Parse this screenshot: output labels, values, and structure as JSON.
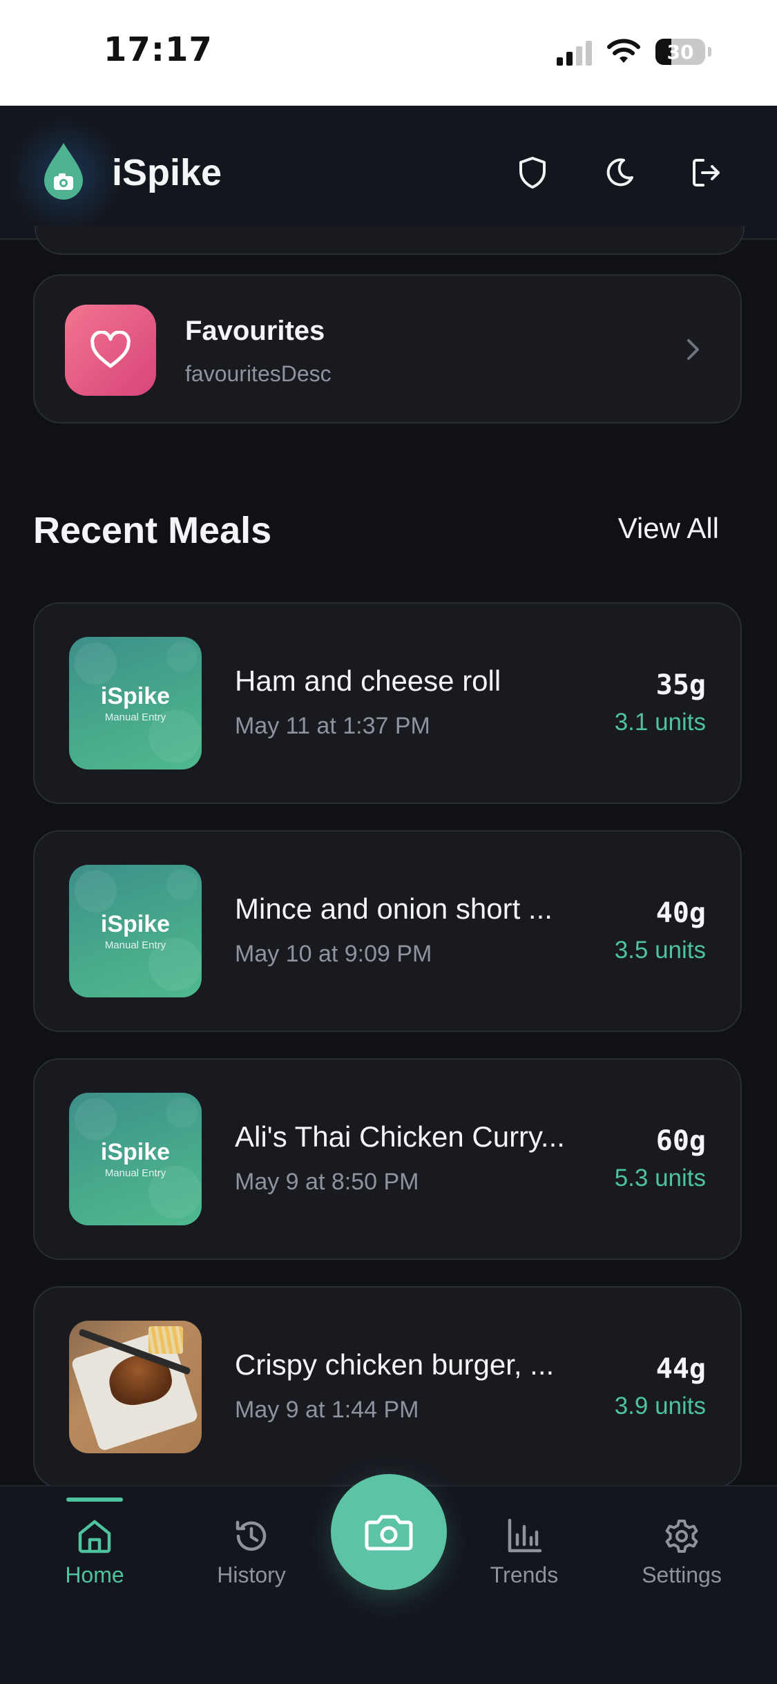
{
  "status_bar": {
    "time": "17:17",
    "battery": "30"
  },
  "header": {
    "title": "iSpike"
  },
  "favourites": {
    "title": "Favourites",
    "description": "favouritesDesc"
  },
  "recent_meals": {
    "title": "Recent Meals",
    "view_all": "View All",
    "placeholder_brand": "iSpike",
    "placeholder_sub": "Manual Entry",
    "items": [
      {
        "name": "Ham and cheese roll",
        "date": "May 11 at 1:37 PM",
        "carbs": "35g",
        "units": "3.1 units"
      },
      {
        "name": "Mince and onion short ...",
        "date": "May 10 at 9:09 PM",
        "carbs": "40g",
        "units": "3.5 units"
      },
      {
        "name": "Ali's Thai Chicken Curry...",
        "date": "May 9 at 8:50 PM",
        "carbs": "60g",
        "units": "5.3 units"
      },
      {
        "name": "Crispy chicken burger, ...",
        "date": "May 9 at 1:44 PM",
        "carbs": "44g",
        "units": "3.9 units"
      }
    ]
  },
  "nav": {
    "home": "Home",
    "history": "History",
    "trends": "Trends",
    "settings": "Settings",
    "active": "Home"
  },
  "colors": {
    "accent": "#4fc2a0",
    "background": "#0f1115",
    "card": "#181a20",
    "favourite": "#e35d84"
  },
  "icons": [
    "shield-icon",
    "moon-icon",
    "logout-icon",
    "heart-icon",
    "chevron-right-icon",
    "home-icon",
    "history-icon",
    "camera-icon",
    "trends-icon",
    "settings-icon"
  ]
}
